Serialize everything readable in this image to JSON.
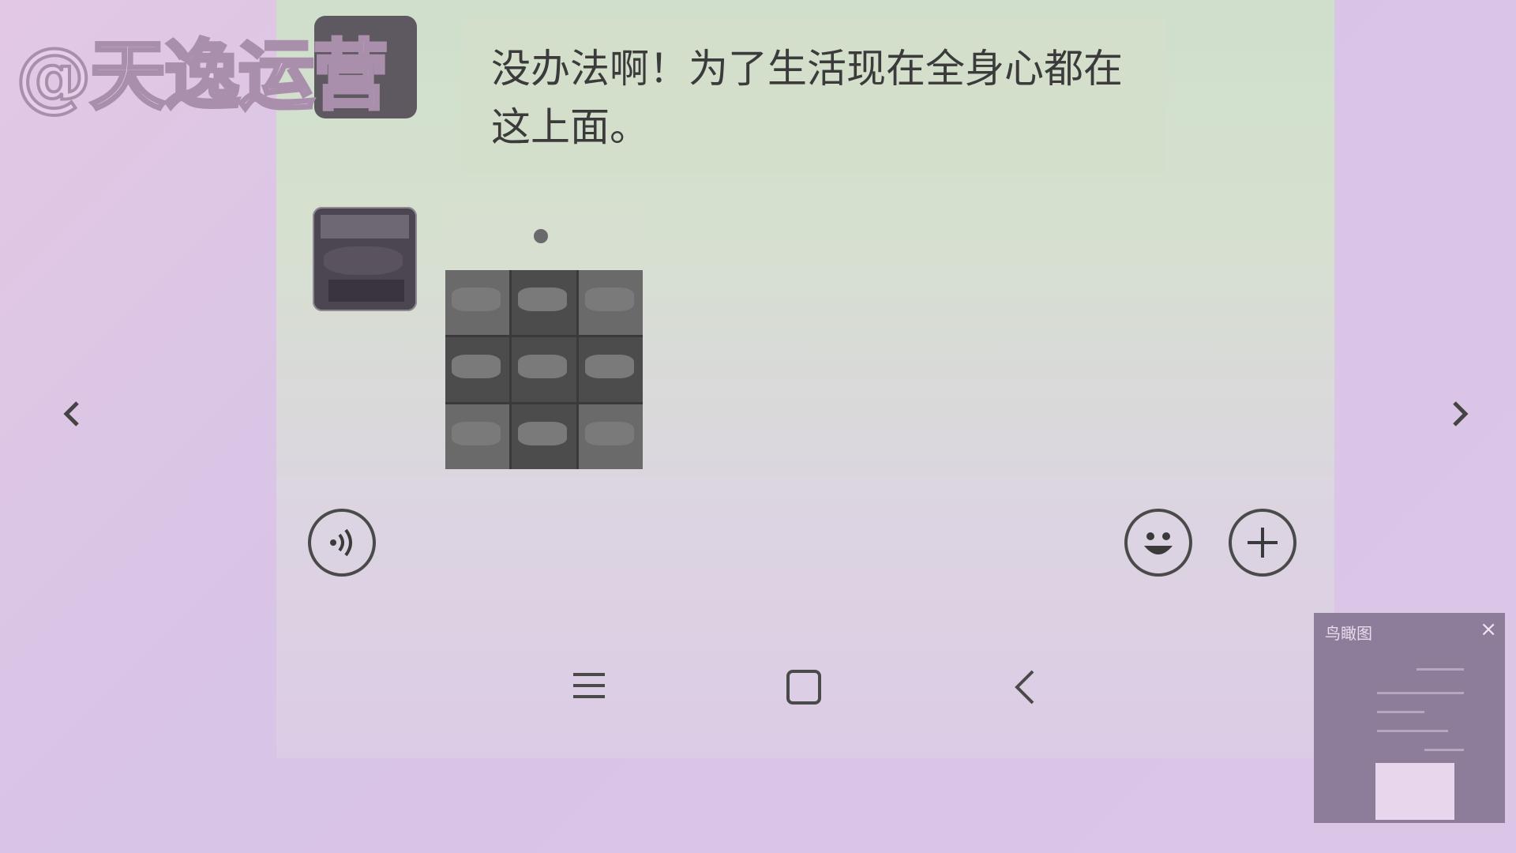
{
  "watermark": {
    "text": "@天逸运营"
  },
  "chat": {
    "message_text": "没办法啊！为了生活现在全身心都在这上面。"
  },
  "input_bar": {
    "voice_icon": "voice-wave-icon",
    "emoji_icon": "smile-face-icon",
    "plus_icon": "plus-circle-icon"
  },
  "nav": {
    "prev_arrow": "‹",
    "next_arrow": "›",
    "menu_icon": "≡",
    "home_icon": "□",
    "back_icon": "‹"
  },
  "thumbnail": {
    "title": "鸟瞰图",
    "close": "×"
  },
  "colors": {
    "bubble_bg": "#d3dfcb",
    "text": "#3b3b3b",
    "page_tint": "#dcc6e8"
  }
}
